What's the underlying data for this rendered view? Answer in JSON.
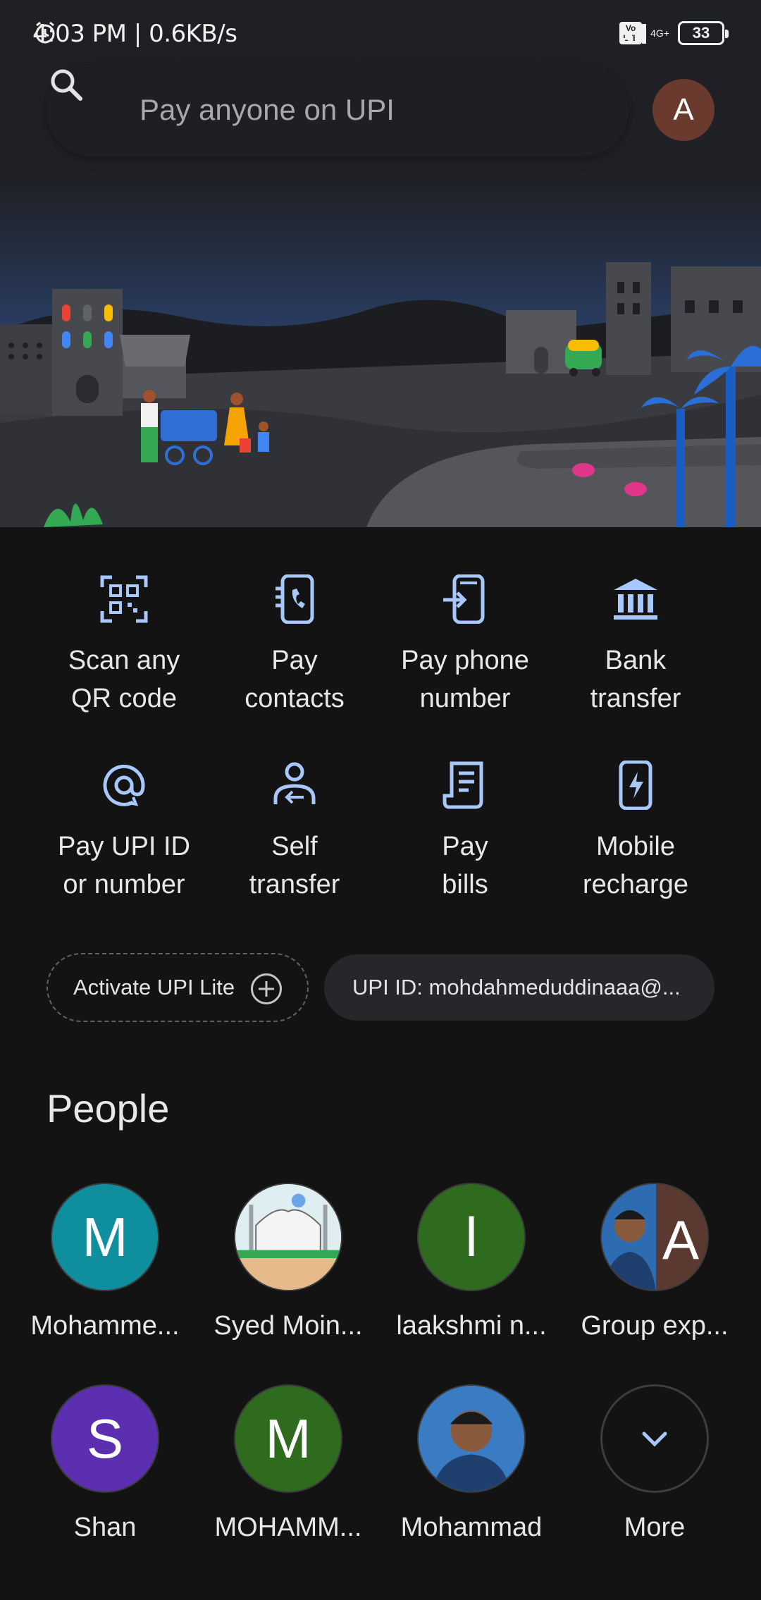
{
  "status_bar": {
    "time_speed": "4:03 PM | 0.6KB/s",
    "network": "4G+",
    "volte": "Vo LTE",
    "battery": "33"
  },
  "search": {
    "placeholder": "Pay anyone on UPI"
  },
  "account": {
    "avatar_letter": "A"
  },
  "actions": [
    {
      "label": "Scan any\nQR code",
      "icon": "qr-scan-icon"
    },
    {
      "label": "Pay\ncontacts",
      "icon": "contacts-phone-icon"
    },
    {
      "label": "Pay phone\nnumber",
      "icon": "phone-pay-icon"
    },
    {
      "label": "Bank\ntransfer",
      "icon": "bank-icon"
    },
    {
      "label": "Pay UPI ID\nor number",
      "icon": "at-sign-icon"
    },
    {
      "label": "Self\ntransfer",
      "icon": "self-transfer-icon"
    },
    {
      "label": "Pay\nbills",
      "icon": "bill-icon"
    },
    {
      "label": "Mobile\nrecharge",
      "icon": "mobile-recharge-icon"
    }
  ],
  "chips": {
    "upi_lite": "Activate UPI Lite",
    "upi_id": "UPI ID: mohdahmeduddinaaa@..."
  },
  "people": {
    "title": "People",
    "contacts": [
      {
        "name": "Mohamme...",
        "initial": "M",
        "color": "#0f8f9e"
      },
      {
        "name": "Syed Moin...",
        "initial": "",
        "color": "#dfe7ea"
      },
      {
        "name": "laakshmi n...",
        "initial": "l",
        "color": "#2f6b1f"
      },
      {
        "name": "Group exp...",
        "initial": "A",
        "color": "#5a3a30"
      },
      {
        "name": "Shan",
        "initial": "S",
        "color": "#5b2fb0"
      },
      {
        "name": "MOHAMM...",
        "initial": "M",
        "color": "#2f6b1f"
      },
      {
        "name": "Mohammad",
        "initial": "",
        "color": "#2a6db0"
      },
      {
        "name": "More",
        "initial": "",
        "color": "#131314"
      }
    ]
  },
  "colors": {
    "accent": "#a8c7fa",
    "background": "#131314"
  }
}
